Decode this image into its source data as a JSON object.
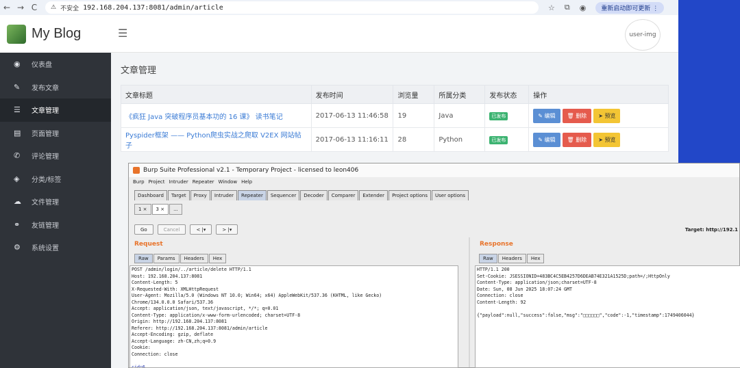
{
  "browser": {
    "nav_back": "←",
    "nav_forward": "→",
    "reload": "C",
    "security_label": "不安全",
    "url": "192.168.204.137:8081/admin/article",
    "update_button": "重新启动即可更新 ⋮"
  },
  "blog": {
    "brand": "My Blog",
    "avatar_text": "user-img",
    "sidebar": [
      {
        "icon": "◉",
        "label": "仪表盘",
        "active": false
      },
      {
        "icon": "✎",
        "label": "发布文章",
        "active": false
      },
      {
        "icon": "☰",
        "label": "文章管理",
        "active": true
      },
      {
        "icon": "▤",
        "label": "页面管理",
        "active": false
      },
      {
        "icon": "✆",
        "label": "评论管理",
        "active": false
      },
      {
        "icon": "◈",
        "label": "分类/标签",
        "active": false
      },
      {
        "icon": "☁",
        "label": "文件管理",
        "active": false
      },
      {
        "icon": "⚭",
        "label": "友链管理",
        "active": false
      },
      {
        "icon": "⚙",
        "label": "系统设置",
        "active": false
      }
    ],
    "page_heading": "文章管理",
    "table": {
      "headers": [
        "文章标题",
        "发布时间",
        "浏览量",
        "所属分类",
        "发布状态",
        "操作"
      ],
      "rows": [
        {
          "title": "《疯狂 Java 突破程序员基本功的 16 课》 读书笔记",
          "time": "2017-06-13 11:46:58",
          "views": "19",
          "category": "Java",
          "status": "已发布"
        },
        {
          "title": "Pyspider框架 —— Python爬虫实战之爬取 V2EX 网站帖子",
          "time": "2017-06-13 11:16:11",
          "views": "28",
          "category": "Python",
          "status": "已发布"
        }
      ],
      "ops": {
        "edit": "编辑",
        "delete": "删除",
        "preview": "预览"
      }
    }
  },
  "burp": {
    "title": "Burp Suite Professional v2.1 - Temporary Project - licensed to leon406",
    "menu": [
      "Burp",
      "Project",
      "Intruder",
      "Repeater",
      "Window",
      "Help"
    ],
    "tabs": [
      "Dashboard",
      "Target",
      "Proxy",
      "Intruder",
      "Repeater",
      "Sequencer",
      "Decoder",
      "Comparer",
      "Extender",
      "Project options",
      "User options"
    ],
    "selected_tab": "Repeater",
    "subtabs": [
      "1 ×",
      "3 ×",
      "..."
    ],
    "go": "Go",
    "cancel": "Cancel",
    "back": "< |▾",
    "forward": "> |▾",
    "target": "Target: http://192.1",
    "request_title": "Request",
    "request_tabs": [
      "Raw",
      "Params",
      "Headers",
      "Hex"
    ],
    "response_title": "Response",
    "response_tabs": [
      "Raw",
      "Headers",
      "Hex"
    ],
    "request_lines": [
      "POST /admin/login/../article/delete HTTP/1.1",
      "Host: 192.168.204.137:8081",
      "Content-Length: 5",
      "X-Requested-With: XMLHttpRequest",
      "User-Agent: Mozilla/5.0 (Windows NT 10.0; Win64; x64) AppleWebKit/537.36 (KHTML, like Gecko)",
      "Chrome/134.0.0.0 Safari/537.36",
      "Accept: application/json, text/javascript, */*; q=0.01",
      "Content-Type: application/x-www-form-urlencoded; charset=UTF-8",
      "Origin: http://192.168.204.137:8081",
      "Referer: http://192.168.204.137:8081/admin/article",
      "Accept-Encoding: gzip, deflate",
      "Accept-Language: zh-CN,zh;q=0.9",
      "Cookie:",
      "Connection: close",
      "",
      "cid=6"
    ],
    "response_lines": [
      "HTTP/1.1 200",
      "Set-Cookie: JSESSIONID=483BC4C5EB4257D6DEAB74E321A1525D;path=/;HttpOnly",
      "Content-Type: application/json;charset=UTF-8",
      "Date: Sun, 08 Jun 2025 18:07:24 GMT",
      "Connection: close",
      "Content-Length: 92",
      "",
      "{\"payload\":null,\"success\":false,\"msg\":\"□□□□□□\",\"code\":-1,\"timestamp\":1749406044}"
    ]
  }
}
